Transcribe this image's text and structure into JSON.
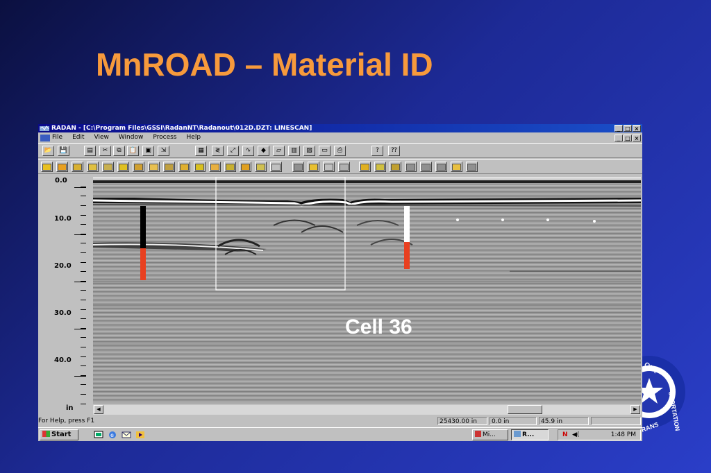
{
  "slide": {
    "title": "MnROAD – Material ID",
    "annotation": "Cell 36"
  },
  "window": {
    "title": "RADAN - [C:\\Program Files\\GSSI\\RadanNT\\Radanout\\012D.DZT:  LINESCAN]",
    "controls": [
      "_",
      "□",
      "×"
    ]
  },
  "menu": [
    "File",
    "Edit",
    "View",
    "Window",
    "Process",
    "Help"
  ],
  "toolbar1_icons": [
    "open-folder",
    "save",
    "new-doc",
    "cut",
    "copy",
    "paste",
    "print-preview",
    "select",
    "chart",
    "wiggle",
    "zoom",
    "wave",
    "palette",
    "gain",
    "split",
    "grid",
    "monitor",
    "printer",
    "help",
    "context-help"
  ],
  "toolbar2_icons": [
    "filter-1",
    "filter-2",
    "filter-3",
    "filter-4",
    "filter-5",
    "filter-6",
    "filter-7",
    "filter-8",
    "filter-9",
    "filter-10",
    "filter-11",
    "filter-12",
    "filter-13",
    "filter-14",
    "filter-15",
    "filter-16",
    "filter-17",
    "filter-18",
    "filter-19",
    "filter-20",
    "filter-21",
    "filter-22",
    "filter-23",
    "filter-24",
    "filter-25",
    "filter-26",
    "filter-27",
    "filter-28"
  ],
  "depth_axis": {
    "labels": [
      "0.0",
      "10.0",
      "20.0",
      "30.0",
      "40.0",
      "in"
    ]
  },
  "status": {
    "help": "For Help, press F1",
    "distance": "25430.00 in",
    "position": "0.0 in",
    "depth": "45.9 in"
  },
  "taskbar": {
    "start": "Start",
    "items": [
      "Mi...",
      "R..."
    ],
    "clock": "1:48 PM"
  },
  "colors": {
    "title": "#f79a3c",
    "marker_red": "#e84020",
    "titlebar": "#0a0a8a"
  }
}
